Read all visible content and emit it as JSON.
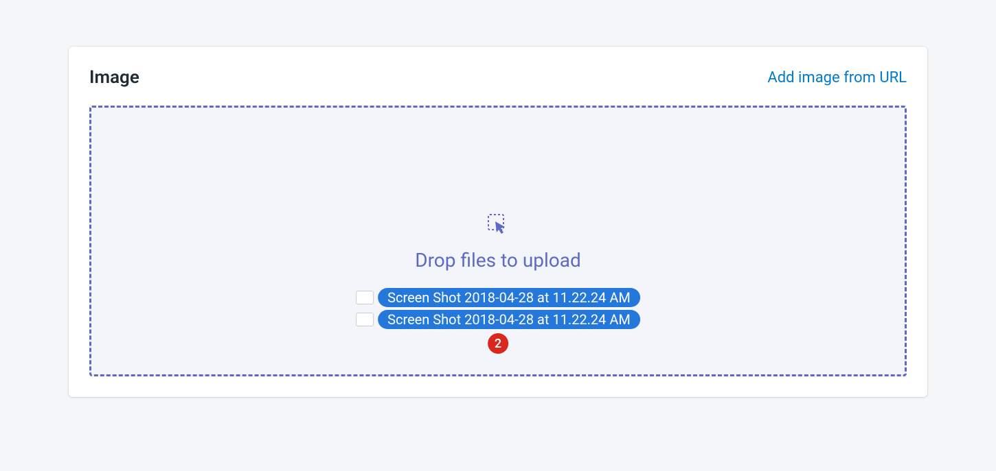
{
  "card": {
    "title": "Image",
    "add_url_label": "Add image from URL"
  },
  "dropzone": {
    "prompt": "Drop files to upload"
  },
  "drag_ghost": {
    "files": [
      "Screen Shot 2018-04-28 at 11.22.24 AM",
      "Screen Shot 2018-04-28 at 11.22.24 AM"
    ],
    "count_badge": "2"
  }
}
